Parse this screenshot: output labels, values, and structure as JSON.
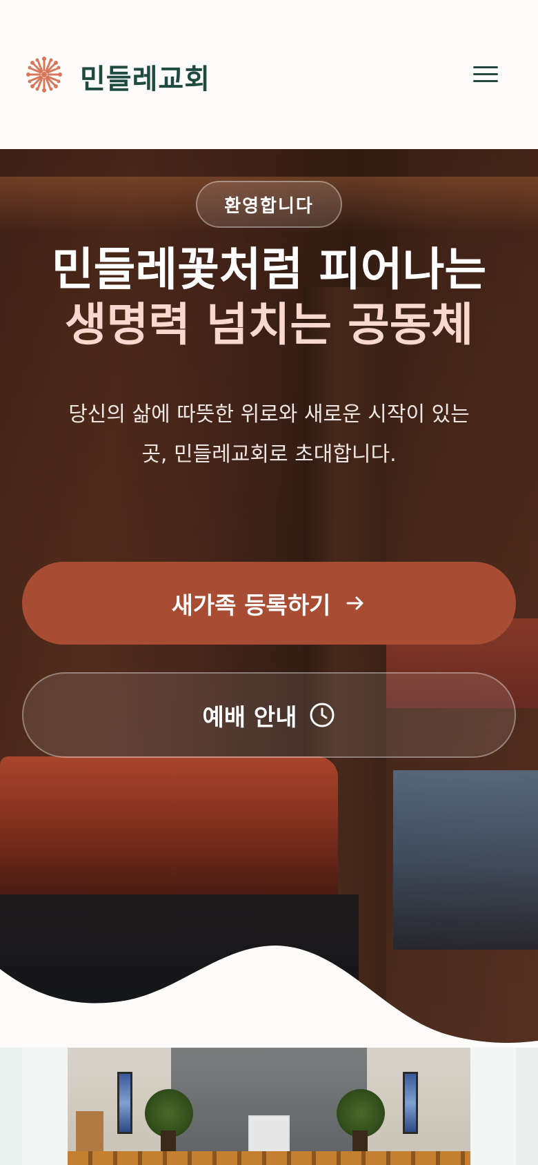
{
  "header": {
    "brand": "민들레교회",
    "logo_icon": "dandelion-logo-icon",
    "menu_icon": "hamburger-menu-icon"
  },
  "hero": {
    "badge": "환영합니다",
    "headline_line1": "민들레꽃처럼 피어나는",
    "headline_line2": "생명력 넘치는 공동체",
    "subtitle_line1": "당신의 삶에 따뜻한 위로와 새로운 시작이 있는",
    "subtitle_line2": "곳, 민들레교회로 초대합니다.",
    "primary_button": "새가족 등록하기",
    "primary_button_icon": "arrow-right-icon",
    "secondary_button": "예배 안내",
    "secondary_button_icon": "clock-icon"
  },
  "colors": {
    "brand_text": "#1e4a3f",
    "accent": "#a84c33",
    "logo": "#d9775c",
    "headline_highlight": "#f8d8cf"
  }
}
